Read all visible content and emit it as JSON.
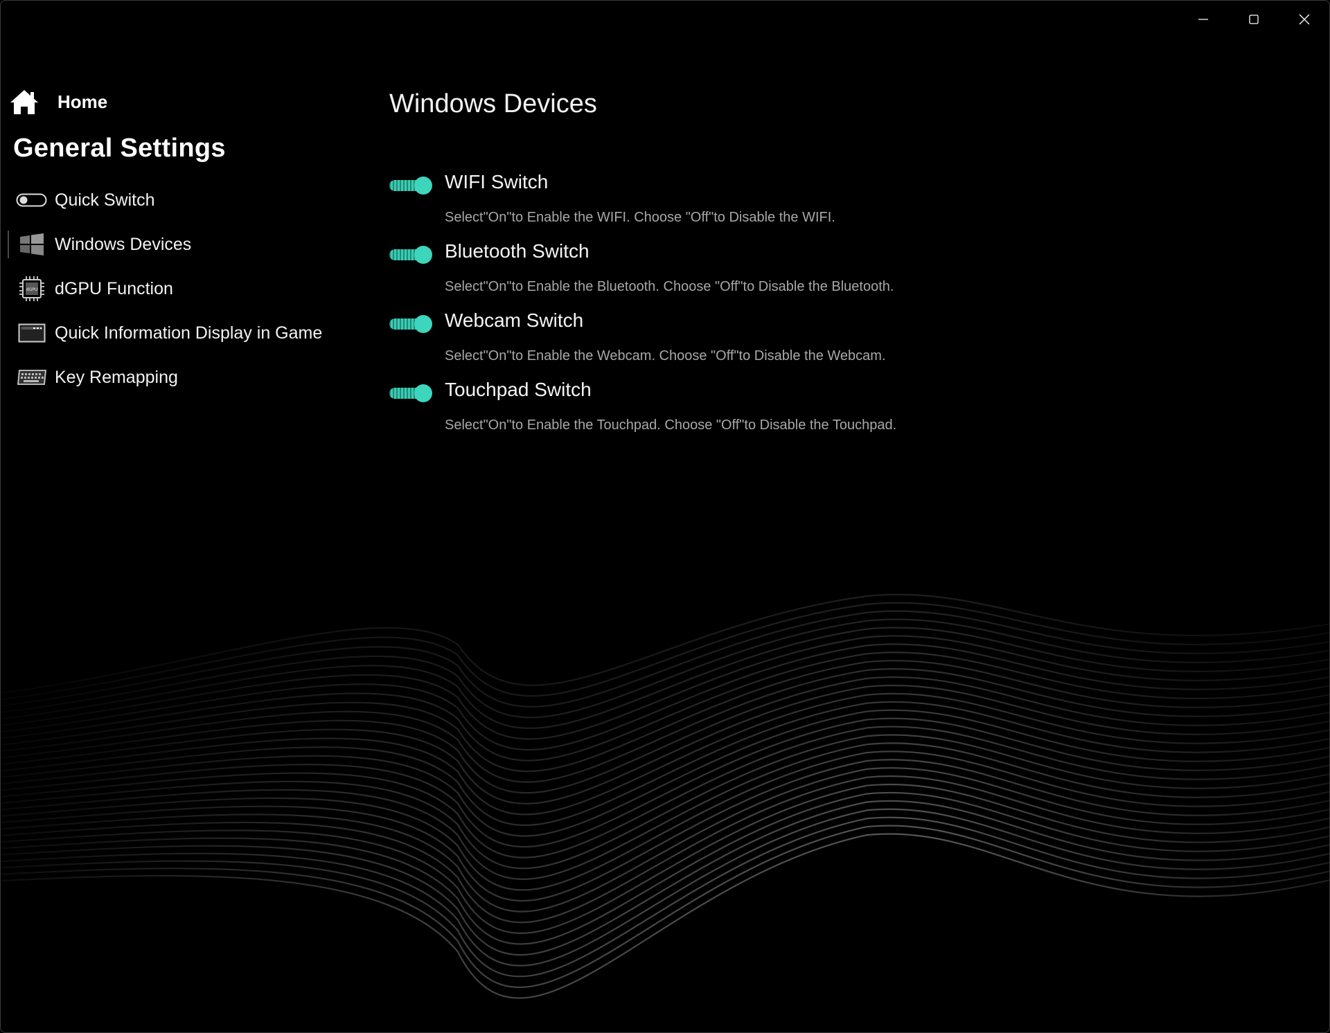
{
  "window": {
    "controls": {
      "minimize": "minimize-icon",
      "maximize": "maximize-icon",
      "close": "close-icon"
    }
  },
  "sidebar": {
    "home_label": "Home",
    "section_title": "General Settings",
    "items": [
      {
        "label": "Quick Switch",
        "icon": "toggle-icon",
        "active": false
      },
      {
        "label": "Windows Devices",
        "icon": "windows-icon",
        "active": true
      },
      {
        "label": "dGPU Function",
        "icon": "gpu-chip-icon",
        "active": false
      },
      {
        "label": "Quick Information Display in Game",
        "icon": "display-icon",
        "active": false
      },
      {
        "label": "Key Remapping",
        "icon": "keyboard-icon",
        "active": false
      }
    ]
  },
  "main": {
    "title": "Windows Devices",
    "settings": [
      {
        "title": "WIFI Switch",
        "description": "Select\"On\"to Enable the WIFI. Choose \"Off\"to Disable the WIFI.",
        "enabled": true
      },
      {
        "title": "Bluetooth Switch",
        "description": "Select\"On\"to Enable the Bluetooth. Choose \"Off\"to Disable the Bluetooth.",
        "enabled": true
      },
      {
        "title": "Webcam Switch",
        "description": "Select\"On\"to Enable the Webcam. Choose \"Off\"to Disable the Webcam.",
        "enabled": true
      },
      {
        "title": "Touchpad Switch",
        "description": "Select\"On\"to Enable the Touchpad. Choose \"Off\"to Disable the Touchpad.",
        "enabled": true
      }
    ]
  },
  "colors": {
    "background": "#000000",
    "accent": "#3dd6bd",
    "text": "#f2f2f2",
    "muted_text": "#a8a8a8"
  }
}
